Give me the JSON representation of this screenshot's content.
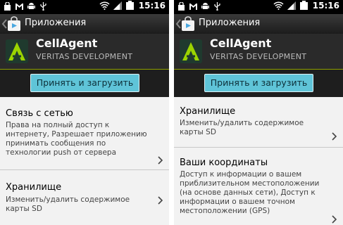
{
  "status_bar": {
    "time": "15:16"
  },
  "header": {
    "title": "Приложения"
  },
  "app": {
    "name": "CellAgent",
    "developer": "VERITAS DEVELOPMENT"
  },
  "accept_button": {
    "label": "Принять и загрузить"
  },
  "left_screen": {
    "permissions": [
      {
        "title": "Связь с сетью",
        "description": "Права на полный доступ к интернету, Разрешает приложению принимать сообщения по технологии push от сервера"
      },
      {
        "title": "Хранилище",
        "description": "Изменить/удалить содержимое карты SD"
      }
    ]
  },
  "right_screen": {
    "permissions": [
      {
        "title": "Хранилище",
        "description": "Изменить/удалить содержимое карты SD"
      },
      {
        "title": "Ваши координаты",
        "description": "Доступ к информации о вашем приблизительном местоположении (на основе данных сети), Доступ к информации о вашем точном местоположении (GPS)"
      }
    ]
  },
  "colors": {
    "accent": "#8fa000",
    "button": "#5fc4d8",
    "header": "#2a2a2a"
  },
  "icons": [
    "shopping-bag-icon",
    "gmail-icon",
    "android-icon",
    "usb-icon",
    "wifi-icon",
    "signal-icon",
    "battery-icon",
    "market-icon",
    "cellagent-app-icon",
    "chevron-right-icon"
  ]
}
